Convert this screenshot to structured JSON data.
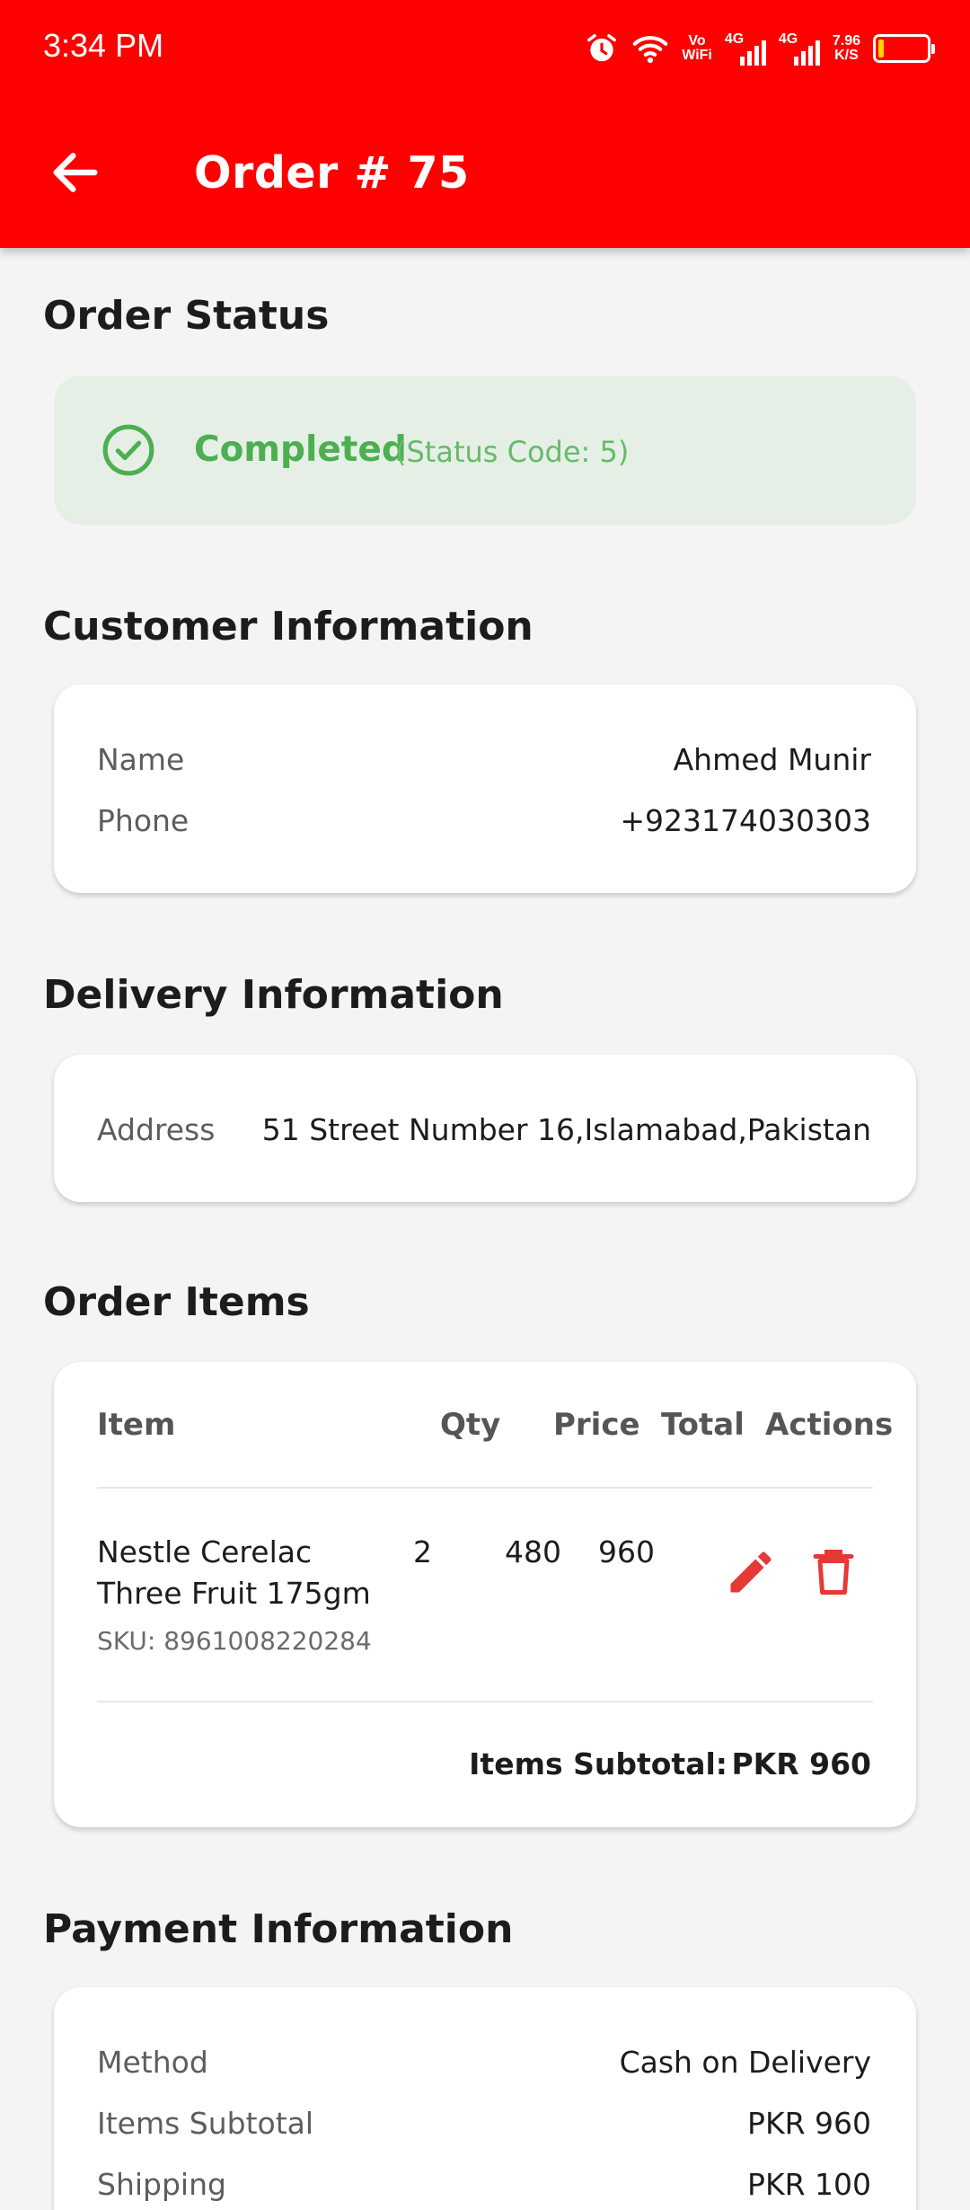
{
  "status_bar": {
    "time": "3:34 PM",
    "vowifi": [
      "Vo",
      "WiFi"
    ],
    "net1": "4G",
    "net2": "4G",
    "speed": [
      "7.96",
      "K/S"
    ],
    "battery_level": 0.12
  },
  "header": {
    "title": "Order # 75"
  },
  "order_status": {
    "section_title": "Order Status",
    "status": "Completed",
    "status_code": "(Status Code: 5)",
    "color": "#4caf50"
  },
  "customer": {
    "section_title": "Customer Information",
    "name_label": "Name",
    "name_value": "Ahmed Munir",
    "phone_label": "Phone",
    "phone_value": "+923174030303"
  },
  "delivery": {
    "section_title": "Delivery Information",
    "address_label": "Address",
    "address_value": "51 Street Number 16,Islamabad,Pakistan"
  },
  "items": {
    "section_title": "Order Items",
    "headers": {
      "item": "Item",
      "qty": "Qty",
      "price": "Price",
      "total": "Total",
      "actions": "Actions"
    },
    "rows": [
      {
        "name_line1": "Nestle Cerelac",
        "name_line2": "Three Fruit 175gm",
        "sku": "SKU: 8961008220284",
        "qty": "2",
        "price": "480",
        "total": "960"
      }
    ],
    "subtotal_label": "Items Subtotal:",
    "subtotal_value": "PKR 960"
  },
  "payment": {
    "section_title": "Payment Information",
    "method_label": "Method",
    "method_value": "Cash on Delivery",
    "subtotal_label": "Items Subtotal",
    "subtotal_value": "PKR 960",
    "shipping_label": "Shipping",
    "shipping_value": "PKR 100"
  },
  "colors": {
    "accent": "#ff0000",
    "success": "#4caf50",
    "action_red": "#e53935"
  }
}
